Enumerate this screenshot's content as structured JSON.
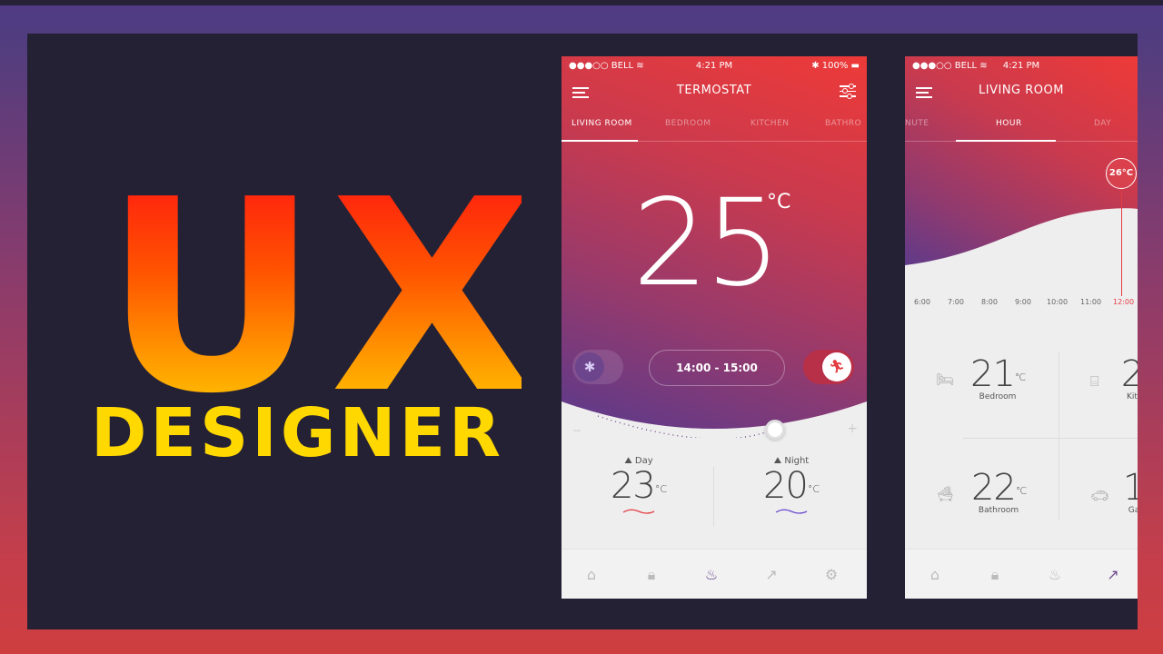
{
  "hero": {
    "line1": "UX",
    "line2": "DESIGNER"
  },
  "phone1": {
    "status": {
      "carrier": "●●●○○ BELL ≋",
      "time": "4:21 PM",
      "battery": "✱ 100% ▬"
    },
    "title": "TERMOSTAT",
    "tabs": [
      "LIVING ROOM",
      "BEDROOM",
      "KITCHEN",
      "BATHRO"
    ],
    "temperature": "25",
    "unit": "°C",
    "time_range": "14:00 - 15:00",
    "minus": "−",
    "plus": "+",
    "day": {
      "label": "Day",
      "value": "23",
      "unit": "°C"
    },
    "night": {
      "label": "Night",
      "value": "20",
      "unit": "°C"
    }
  },
  "phone2": {
    "status": {
      "carrier": "●●●○○ BELL ≋",
      "time": "4:21 PM"
    },
    "title": "LIVING ROOM",
    "tabs": [
      "NUTE",
      "HOUR",
      "DAY"
    ],
    "current": "26°C",
    "hours": [
      "6:00",
      "7:00",
      "8:00",
      "9:00",
      "10:00",
      "11:00",
      "12:00"
    ],
    "rooms": [
      {
        "name": "Bedroom",
        "value": "21",
        "unit": "°C"
      },
      {
        "name": "Kit",
        "value": "2",
        "unit": ""
      },
      {
        "name": "Bathroom",
        "value": "22",
        "unit": "°C"
      },
      {
        "name": "Ga",
        "value": "1",
        "unit": ""
      }
    ]
  },
  "colors": {
    "accent": "#e33c40",
    "purple": "#5a3a8c",
    "yellow": "#ffd800"
  },
  "icons": [
    "home-icon",
    "lock-icon",
    "heater-icon",
    "chart-icon",
    "gear-icon"
  ]
}
